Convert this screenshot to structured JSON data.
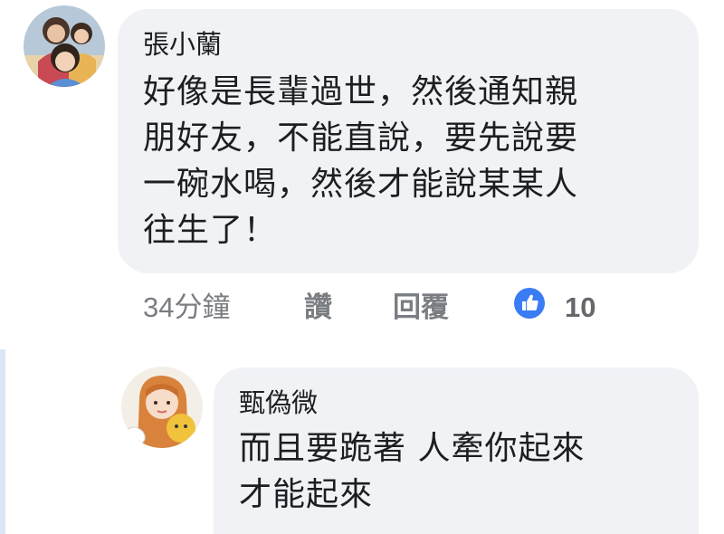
{
  "comment": {
    "author": "張小蘭",
    "lines": [
      "好像是長輩過世，然後通知親",
      "朋好友，不能直說，要先說要",
      "一碗水喝，然後才能說某某人",
      "往生了！"
    ],
    "timestamp": "34分鐘",
    "like_label": "讚",
    "reply_label": "回覆",
    "reaction_icon": "thumbs-up-icon",
    "reaction_count": "10"
  },
  "reply": {
    "author": "甄偽微",
    "lines": [
      "而且要跪著 人牽你起來",
      "才能起來"
    ]
  },
  "colors": {
    "bubble": "#f1f2f6",
    "like_blue": "#3a7cf4",
    "meta_gray": "#7a7d82"
  }
}
